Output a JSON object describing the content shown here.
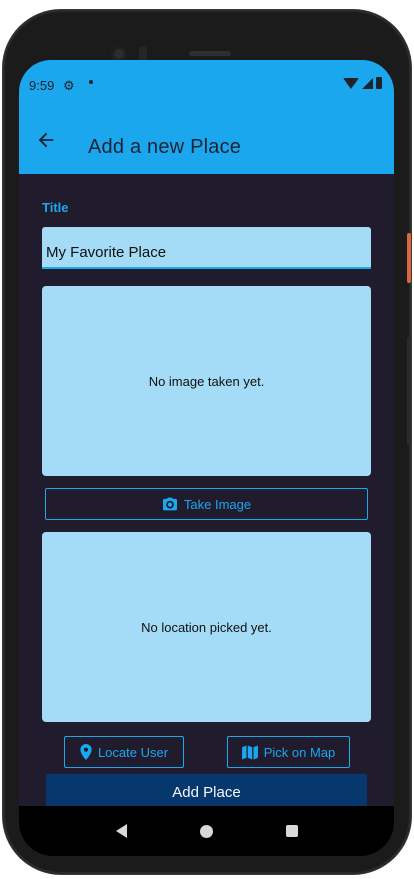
{
  "status_bar": {
    "time": "9:59",
    "settings_icon": "gear-icon",
    "wifi_icon": "wifi-icon",
    "signal_icon": "cell-signal-icon",
    "battery_icon": "battery-icon"
  },
  "app_bar": {
    "title": "Add a new Place",
    "back_icon": "arrow-back-icon"
  },
  "form": {
    "title_label": "Title",
    "title_value": "My Favorite Place",
    "image_placeholder": "No image taken yet.",
    "take_image_label": "Take Image",
    "take_image_icon": "camera-icon",
    "location_placeholder": "No location picked yet.",
    "locate_user_label": "Locate User",
    "locate_user_icon": "location-pin-icon",
    "pick_on_map_label": "Pick on Map",
    "pick_on_map_icon": "map-icon",
    "add_place_label": "Add Place"
  },
  "nav_bar": {
    "back": "nav-back-icon",
    "home": "nav-home-icon",
    "recents": "nav-recents-icon"
  },
  "colors": {
    "accent": "#1aa7ee",
    "background": "#201c2e",
    "preview_fill": "#a4dcf7",
    "primary_button": "#06386e"
  }
}
